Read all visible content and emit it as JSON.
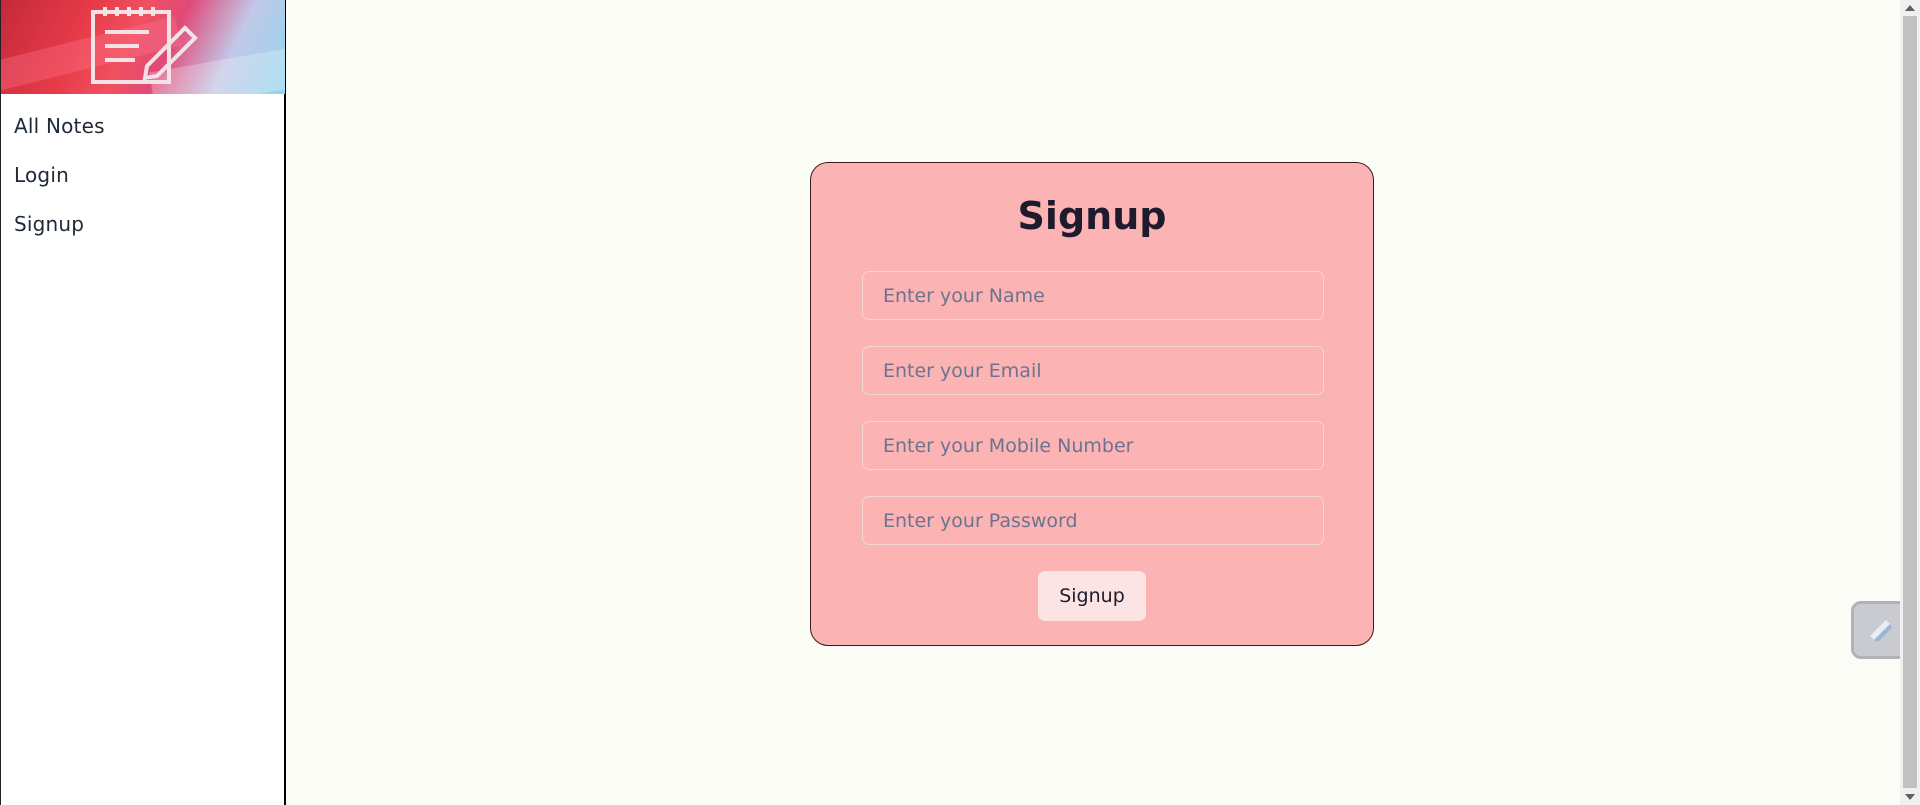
{
  "sidebar": {
    "logo_icon": "notepad-pencil-icon",
    "items": [
      {
        "label": "All Notes"
      },
      {
        "label": "Login"
      },
      {
        "label": "Signup"
      }
    ]
  },
  "form": {
    "title": "Signup",
    "fields": [
      {
        "placeholder": "Enter your Name",
        "value": ""
      },
      {
        "placeholder": "Enter your Email",
        "value": ""
      },
      {
        "placeholder": "Enter your Mobile Number",
        "value": ""
      },
      {
        "placeholder": "Enter your Password",
        "value": ""
      }
    ],
    "submit_label": "Signup"
  },
  "widget": {
    "icon": "pen-widget-icon"
  },
  "colors": {
    "card_bg": "#fbb3b3",
    "page_bg": "#fcfcf7",
    "button_bg": "#fde4e4"
  }
}
